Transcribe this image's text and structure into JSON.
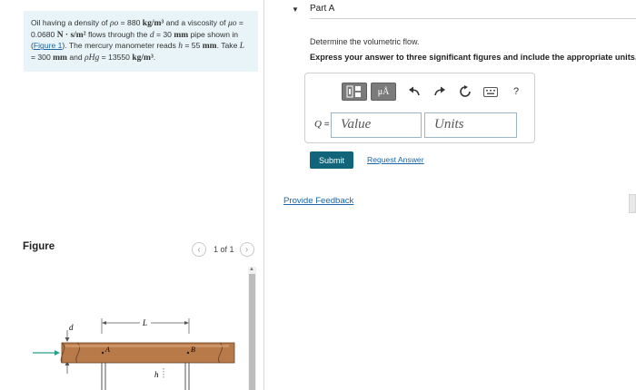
{
  "problem": {
    "s1": "Oil having a density of ",
    "rho_o": "ρo",
    "s2": " = 880 ",
    "u1": "kg/m³",
    "s3": " and a viscosity of ",
    "mu_o": "μo",
    "s4": " = 0.0680 ",
    "u2": "N · s/m²",
    "s5": " flows through the ",
    "d": "d",
    "s6": " = 30 ",
    "u3": "mm",
    "s7": " pipe shown in (",
    "figure_link": "Figure 1",
    "s8": "). The mercury manometer reads ",
    "h": "h",
    "s9": " = 55 ",
    "u4": "mm",
    "s10": ". Take ",
    "L": "L",
    "s11": " = 300 ",
    "u5": "mm",
    "s12": " and ",
    "rho_hg": "ρHg",
    "s13": " = 13550 ",
    "u6": "kg/m³",
    "s14": "."
  },
  "figure": {
    "title": "Figure",
    "pager_text": "1 of 1",
    "labels": {
      "d": "d",
      "L": "L",
      "A": "A",
      "B": "B",
      "h": "h"
    }
  },
  "part": {
    "title": "Part A",
    "prompt": "Determine the volumetric flow.",
    "instruction": "Express your answer to three significant figures and include the appropriate units.",
    "q_label": "Q",
    "q_eq": " =",
    "value_placeholder": "Value",
    "units_placeholder": "Units",
    "mu_button": "μÅ",
    "help_icon": "?",
    "submit": "Submit",
    "request_answer": "Request Answer"
  },
  "feedback_link": "Provide Feedback",
  "colors": {
    "submit_bg": "#12647a",
    "link": "#1a66a8",
    "problem_bg": "#e8f4f7",
    "pipe": "#b97a4a",
    "toolbar_btn": "#7b7b7b"
  },
  "icons": [
    "templates-icon",
    "undo-icon",
    "redo-icon",
    "reset-icon",
    "keyboard-icon",
    "help-icon",
    "flow-arrow-icon"
  ]
}
